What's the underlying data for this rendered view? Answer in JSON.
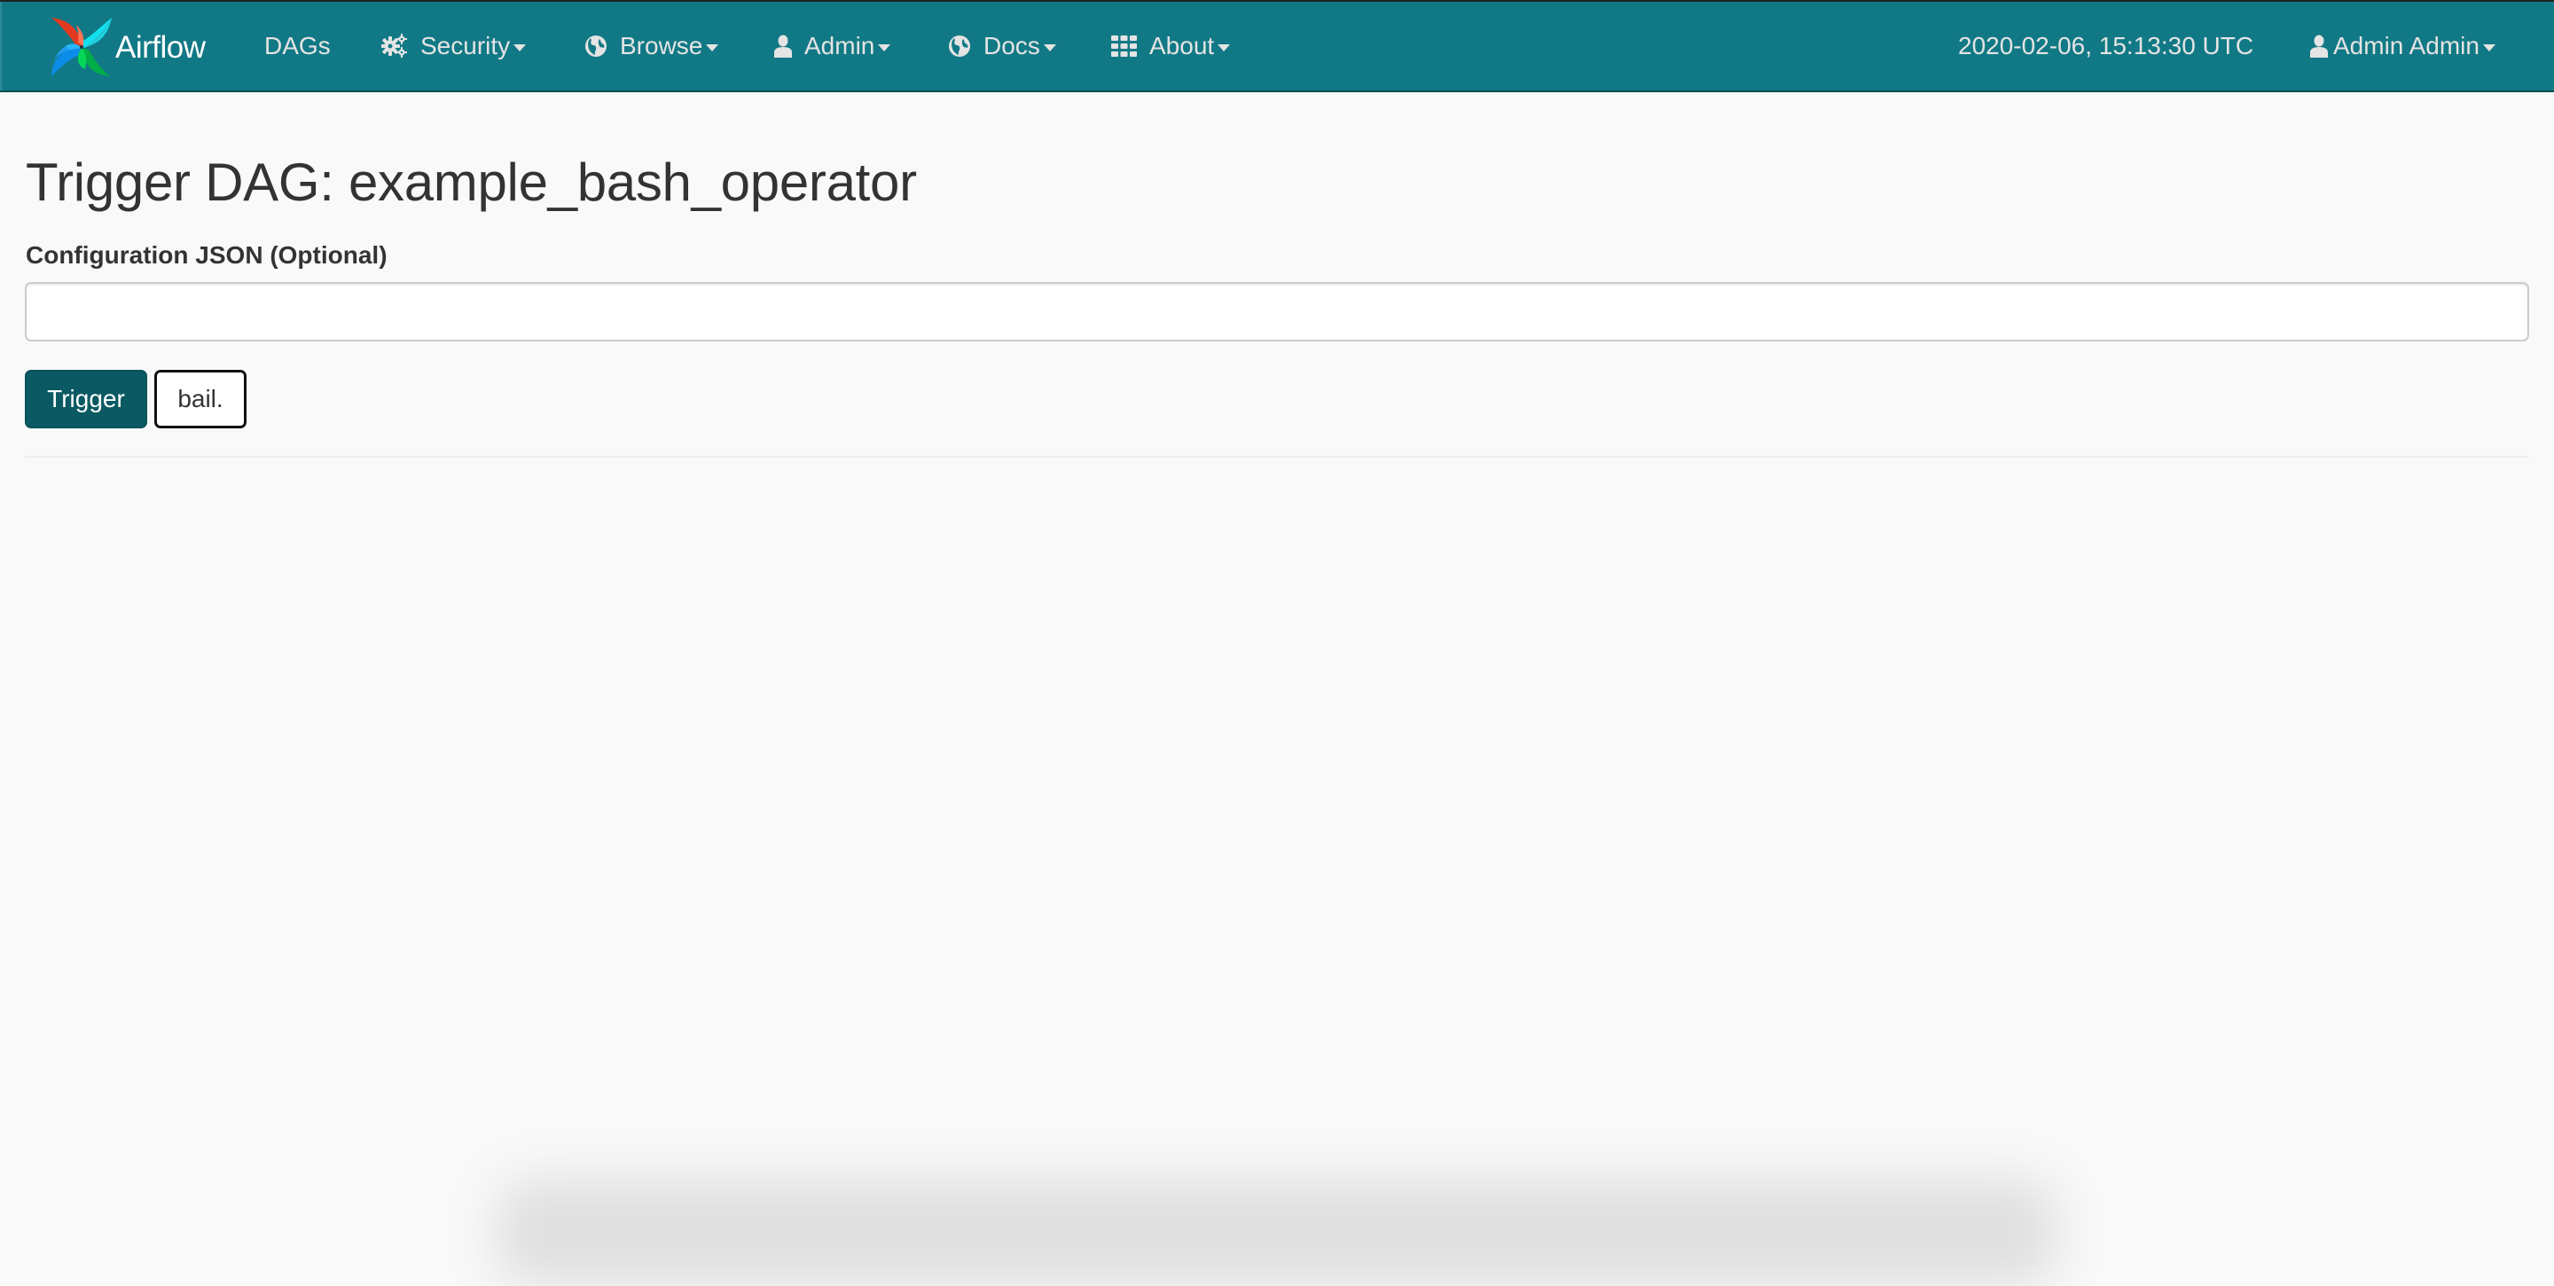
{
  "navbar": {
    "brand": {
      "label": "Airflow",
      "logo_icon": "airflow-pinwheel-logo"
    },
    "items": [
      {
        "label": "DAGs",
        "icon": null,
        "has_dropdown": false
      },
      {
        "label": "Security",
        "icon": "gears-icon",
        "has_dropdown": true
      },
      {
        "label": "Browse",
        "icon": "globe-icon",
        "has_dropdown": true
      },
      {
        "label": "Admin",
        "icon": "user-icon",
        "has_dropdown": true
      },
      {
        "label": "Docs",
        "icon": "globe-icon",
        "has_dropdown": true
      },
      {
        "label": "About",
        "icon": "th-grid-icon",
        "has_dropdown": true
      }
    ],
    "datetime": "2020-02-06, 15:13:30 UTC",
    "user_menu": {
      "label": "Admin Admin",
      "icon": "user-icon",
      "has_dropdown": true
    },
    "colors": {
      "background": "#117985",
      "text": "#e4e4e4"
    }
  },
  "main": {
    "title": "Trigger DAG: example_bash_operator",
    "conf_field": {
      "label": "Configuration JSON (Optional)",
      "value": "",
      "placeholder": ""
    },
    "buttons": {
      "trigger_label": "Trigger",
      "bail_label": "bail."
    },
    "colors": {
      "primary_button": "#0b5a63",
      "page_background": "#f9f9f9",
      "text": "#333333"
    }
  }
}
